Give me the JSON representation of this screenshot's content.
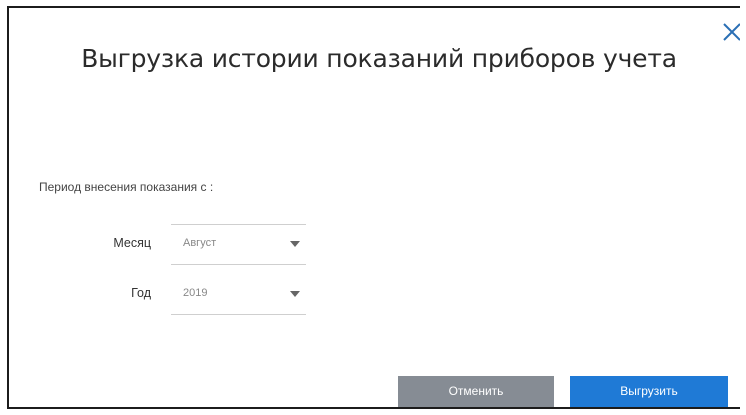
{
  "dialog": {
    "title": "Выгрузка истории показаний приборов учета",
    "period_label": "Период внесения показания с :",
    "fields": {
      "month": {
        "label": "Месяц",
        "value": "Август"
      },
      "year": {
        "label": "Год",
        "value": "2019"
      }
    },
    "buttons": {
      "cancel": "Отменить",
      "export": "Выгрузить"
    }
  },
  "colors": {
    "cancel_button": "#868c94",
    "export_button": "#1f7ad6",
    "close_icon": "#2a6fb5"
  },
  "icons": {
    "close": "close-icon",
    "dropdown": "chevron-down-icon"
  }
}
